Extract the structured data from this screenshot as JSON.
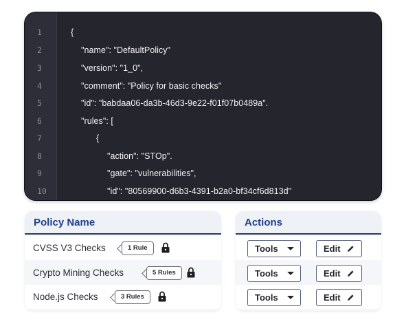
{
  "editor": {
    "lines": [
      {
        "num": "1",
        "text": "{"
      },
      {
        "num": "2",
        "text": "\"name\": \"DefaultPolicy\""
      },
      {
        "num": "3",
        "text": "\"version\": \"1_0\","
      },
      {
        "num": "4",
        "text": "\"comment\": \"Policy for basic checks\""
      },
      {
        "num": "5",
        "text": "\"id\": \"babdaa06-da3b-46d3-9e22-f01f07b0489a\"."
      },
      {
        "num": "6",
        "text": "\"rules\": ["
      },
      {
        "num": "7",
        "text": "{"
      },
      {
        "num": "8",
        "text": "\"action\": \"STOp\"."
      },
      {
        "num": "9",
        "text": "\"gate\": \"vulnerabilities\","
      },
      {
        "num": "10",
        "text": "\"id\": \"80569900-d6b3-4391-b2a0-bf34cf6d813d\""
      }
    ]
  },
  "policy_table": {
    "header": "Policy Name",
    "rows": [
      {
        "name": "CVSS V3 Checks",
        "rules": "1 Rule",
        "icon": "lock-icon"
      },
      {
        "name": "Crypto Mining Checks",
        "rules": "5 Rules",
        "icon": "lock-icon"
      },
      {
        "name": "Node.js Checks",
        "rules": "3 Rules",
        "icon": "lock-icon"
      }
    ]
  },
  "actions_table": {
    "header": "Actions",
    "rows": [
      {
        "tools_label": "Tools",
        "edit_label": "Edit"
      },
      {
        "tools_label": "Tools",
        "edit_label": "Edit"
      },
      {
        "tools_label": "Tools",
        "edit_label": "Edit"
      }
    ]
  },
  "colors": {
    "editor_bg": "#24252d",
    "header_text": "#1f3f8a",
    "header_rule": "#2b3b5c"
  }
}
